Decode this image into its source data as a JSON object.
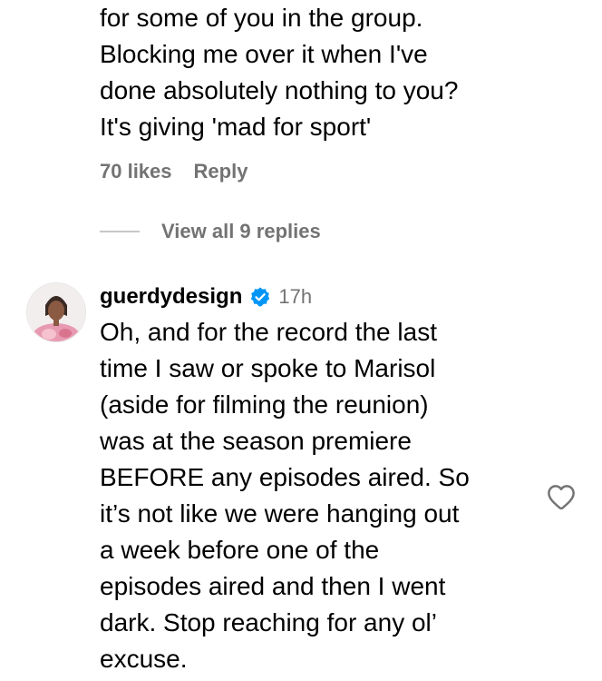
{
  "previous_comment": {
    "lines": [
      "for some of you in the group.",
      "Blocking me over it when I've",
      "done absolutely nothing to you?",
      "It's giving 'mad for sport'"
    ],
    "likes": "70 likes",
    "reply_label": "Reply",
    "view_replies": "View all 9 replies"
  },
  "comment": {
    "username": "guerdydesign",
    "verified": true,
    "time": "17h",
    "lines": [
      "Oh, and for the record the last",
      "time I saw or spoke to Marisol",
      "(aside for filming the reunion)",
      "was at the season premiere",
      "BEFORE any episodes aired. So",
      "it’s not like we were hanging out",
      "a week before one of the",
      "episodes aired and then I went",
      "dark. Stop reaching for any ol’",
      "excuse."
    ]
  },
  "colors": {
    "muted": "#737373",
    "verified_blue": "#0095f6",
    "rule": "#c7c7c7"
  },
  "icons": {
    "verified": "verified-badge-icon",
    "like": "heart-outline-icon",
    "avatar": "profile-photo"
  }
}
